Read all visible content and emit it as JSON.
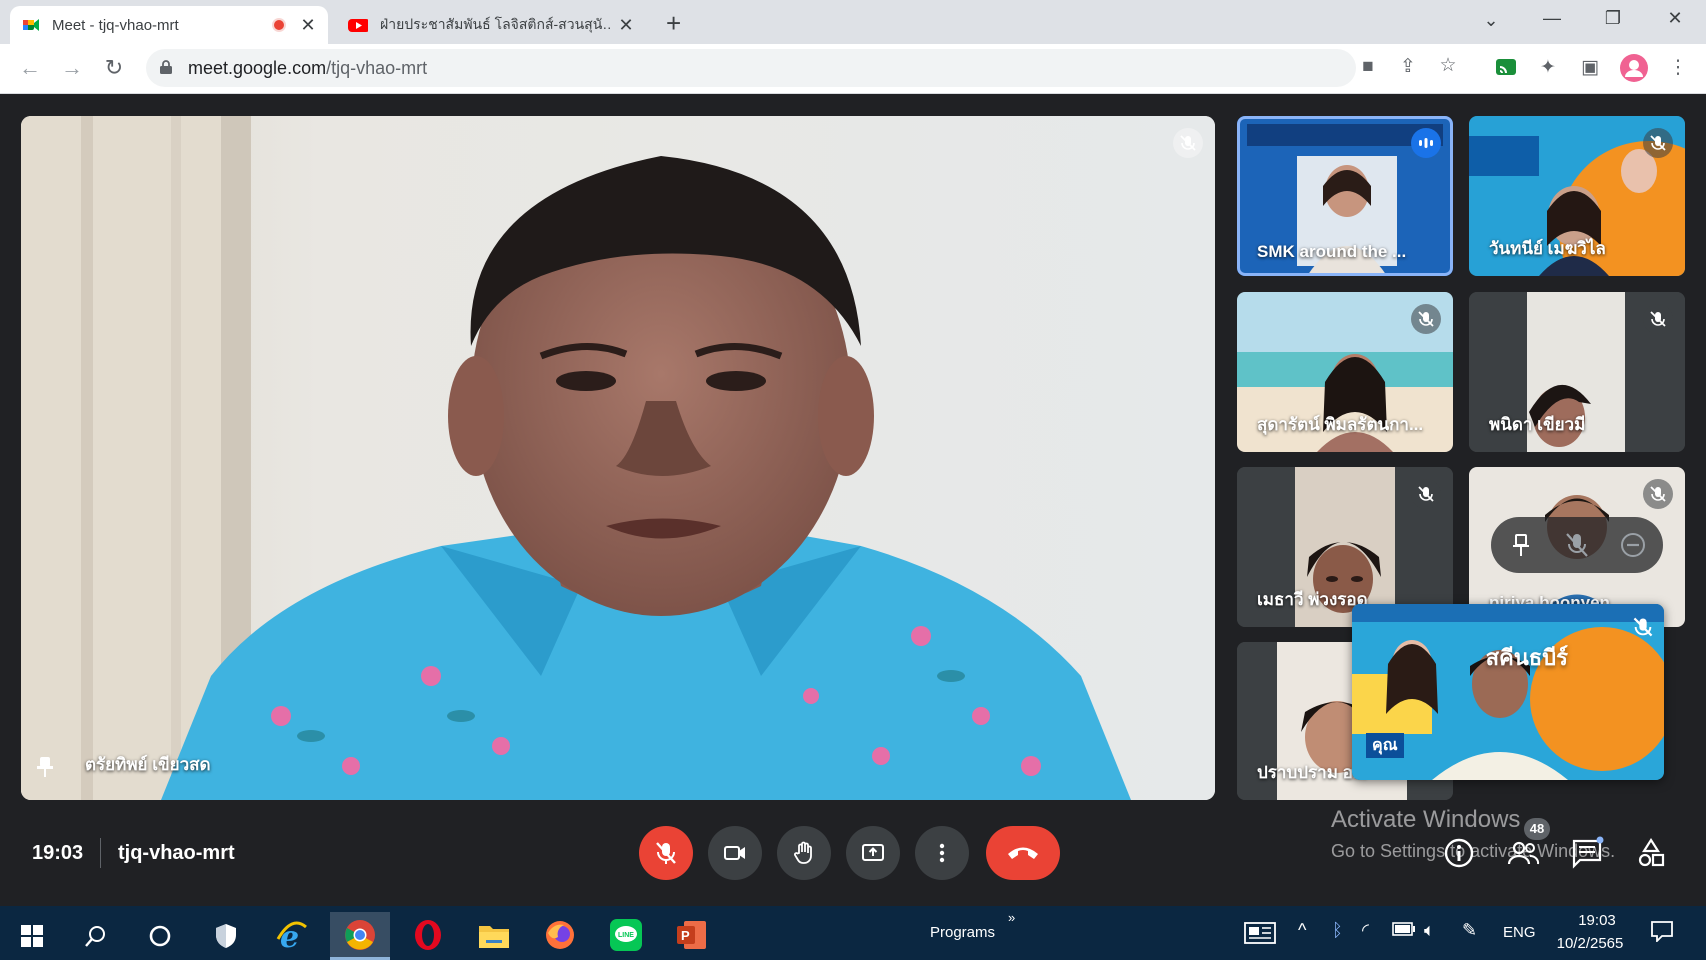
{
  "browser": {
    "tabs": [
      {
        "title": "Meet - tjq-vhao-mrt",
        "active": true,
        "recording": true
      },
      {
        "title": "ฝ่ายประชาสัมพันธ์ โลจิสติกส์-สวนสุนั…",
        "active": false
      }
    ],
    "url_host": "meet.google.com",
    "url_path": "/tjq-vhao-mrt"
  },
  "meet": {
    "main_speaker": "ตรัยทิพย์ เขียวสด",
    "tiles": [
      {
        "name": "SMK around the ..."
      },
      {
        "name": "วันทนีย์ เมฆวิไล"
      },
      {
        "name": "สุดารัตน์ พิมลรัตนกา..."
      },
      {
        "name": "พนิดา เขียวมี"
      },
      {
        "name": "เมธาวี พ่วงรอด"
      },
      {
        "name": "piriya boonyen"
      },
      {
        "name": "ปราบปราม อ..."
      }
    ],
    "self_view_poster": {
      "headline": "สคีนธบีร์",
      "caption": "คุณ"
    },
    "clock": "19:03",
    "meeting_code": "tjq-vhao-mrt",
    "participant_count": "48"
  },
  "watermark": {
    "line1": "Activate Windows",
    "line2": "Go to Settings to activate Windows."
  },
  "taskbar": {
    "programs_label": "Programs",
    "lang": "ENG",
    "time": "19:03",
    "date": "10/2/2565"
  },
  "colors": {
    "meet_bg": "#202124",
    "end_call": "#ea4335",
    "taskbar": "#0b2741",
    "shirt": "#3fb3e0"
  }
}
